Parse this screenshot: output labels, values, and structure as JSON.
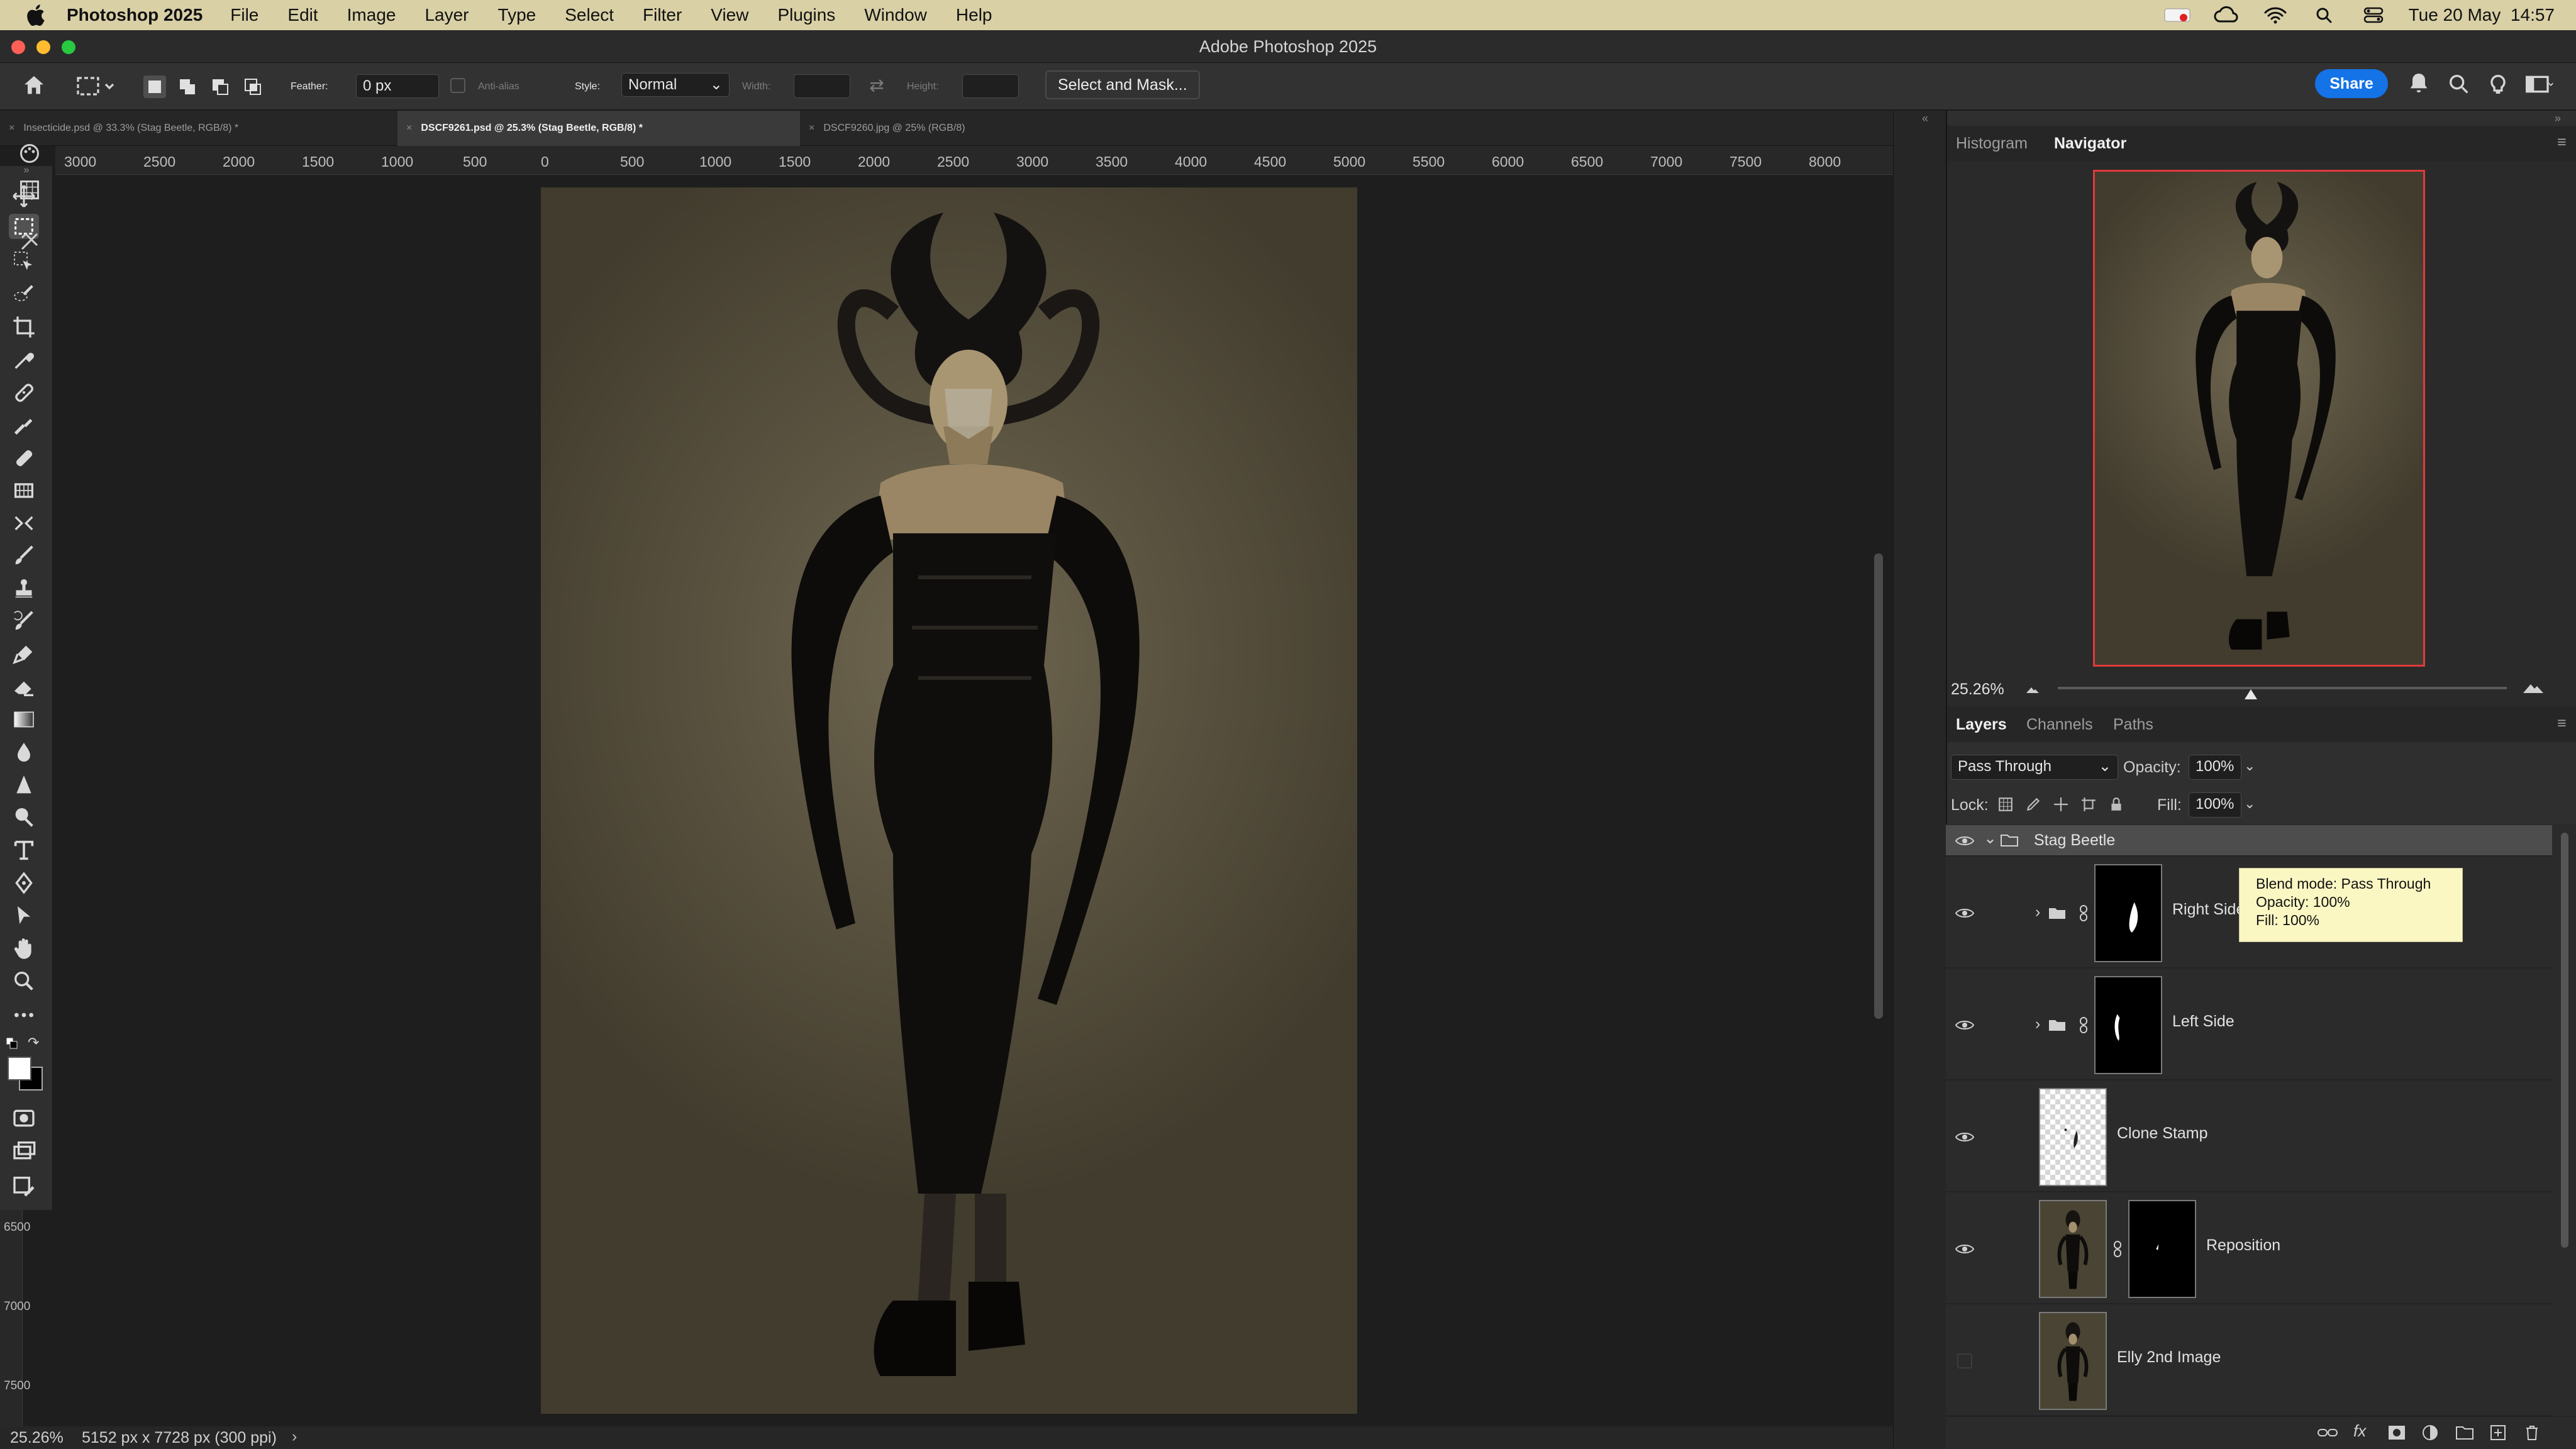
{
  "menubar": {
    "apple_icon": "apple-logo-icon",
    "app_name": "Photoshop 2025",
    "items": [
      "File",
      "Edit",
      "Image",
      "Layer",
      "Type",
      "Select",
      "Filter",
      "View",
      "Plugins",
      "Window",
      "Help"
    ],
    "clock": "Tue 20 May  14:57",
    "status_icons": [
      "screen-record-icon",
      "creative-cloud-icon",
      "wifi-icon",
      "spotlight-search-icon",
      "control-center-icon"
    ]
  },
  "window": {
    "title": "Adobe Photoshop 2025"
  },
  "options": {
    "feather_label": "Feather:",
    "feather_value": "0 px",
    "antialias_label": "Anti-alias",
    "style_label": "Style:",
    "style_value": "Normal",
    "width_label": "Width:",
    "height_label": "Height:",
    "select_mask": "Select and Mask...",
    "share": "Share"
  },
  "doc_tabs": [
    {
      "label": "Insecticide.psd @ 33.3% (Stag Beetle, RGB/8) *",
      "active": false
    },
    {
      "label": "DSCF9261.psd @ 25.3% (Stag Beetle, RGB/8) *",
      "active": true
    },
    {
      "label": "DSCF9260.jpg @ 25% (RGB/8)",
      "active": false
    }
  ],
  "ruler": {
    "h_ticks": [
      "3000",
      "2500",
      "2000",
      "1500",
      "1000",
      "500",
      "0",
      "500",
      "1000",
      "1500",
      "2000",
      "2500",
      "3000",
      "3500",
      "4000",
      "4500",
      "5000",
      "5500",
      "6000",
      "6500",
      "7000",
      "7500",
      "8000"
    ],
    "v_ticks": [
      "6500",
      "7000",
      "7500"
    ]
  },
  "status": {
    "zoom": "25.26%",
    "doc_size": "5152 px x 7728 px (300 ppi)"
  },
  "navigator": {
    "tabs": [
      "Histogram",
      "Navigator"
    ],
    "active_tab": "Navigator",
    "zoom": "25.26%",
    "zoom_fraction": 0.43
  },
  "layers_panel": {
    "tabs": [
      "Layers",
      "Channels",
      "Paths"
    ],
    "active_tab": "Layers",
    "blend_mode": "Pass Through",
    "opacity_label": "Opacity:",
    "opacity": "100%",
    "lock_label": "Lock:",
    "fill_label": "Fill:",
    "fill": "100%",
    "group_name": "Stag Beetle",
    "layers": [
      {
        "name": "Right Side",
        "type": "group-with-mask",
        "visible": true
      },
      {
        "name": "Left Side",
        "type": "group-with-mask",
        "visible": true
      },
      {
        "name": "Clone Stamp",
        "type": "pixel",
        "visible": true
      },
      {
        "name": "Reposition",
        "type": "pixel-with-mask",
        "visible": true
      },
      {
        "name": "Elly 2nd Image",
        "type": "pixel",
        "visible": false
      }
    ]
  },
  "tooltip": {
    "line1": "Blend mode: Pass Through",
    "line2": "Opacity: 100%",
    "line3": "Fill: 100%"
  },
  "colors": {
    "menubar_bg": "#d9d0a6",
    "share_blue": "#1473e6",
    "nav_frame": "#e03a3a",
    "tooltip_bg": "#fbf7c3"
  }
}
